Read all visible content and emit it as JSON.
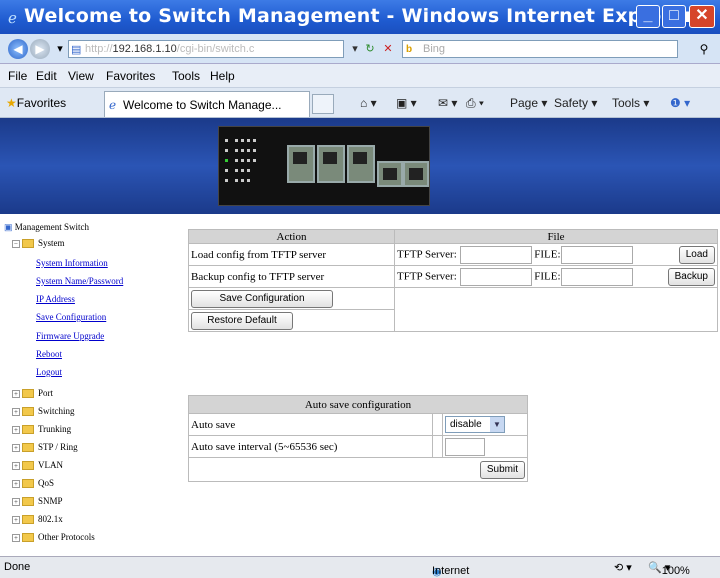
{
  "window": {
    "title": "Welcome to Switch Management - Windows Internet Explorer"
  },
  "address_bar": {
    "url_prefix": "http://",
    "url_host": "192.168.1.10",
    "url_rest": "/cgi-bin/switch.c",
    "search_placeholder": "Bing"
  },
  "menu": [
    "File",
    "Edit",
    "View",
    "Favorites",
    "Tools",
    "Help"
  ],
  "favorites_bar": {
    "favorites_label": "Favorites",
    "tab_title": "Welcome to Switch Manage...",
    "commands": [
      "Page ▾",
      "Safety ▾",
      "Tools ▾"
    ]
  },
  "tree": {
    "root": "Management Switch",
    "system": "System",
    "system_links": [
      "System Information",
      "System Name/Password",
      "IP Address",
      "Save Configuration",
      "Firmware Upgrade",
      "Reboot",
      "Logout"
    ],
    "folders": [
      "Port",
      "Switching",
      "Trunking",
      "STP / Ring",
      "VLAN",
      "QoS",
      "SNMP",
      "802.1x",
      "Other Protocols"
    ]
  },
  "action_table": {
    "header_action": "Action",
    "header_file": "File",
    "rows": [
      {
        "label": "Load config from TFTP server",
        "server_label": "TFTP Server:",
        "file_label": "FILE:",
        "button": "Load"
      },
      {
        "label": "Backup config to TFTP server",
        "server_label": "TFTP Server:",
        "file_label": "FILE:",
        "button": "Backup"
      }
    ],
    "save_button": "Save Configuration",
    "restore_button": "Restore Default"
  },
  "auto_save": {
    "header": "Auto save configuration",
    "auto_save_label": "Auto save",
    "auto_save_value": "disable",
    "interval_label": "Auto save interval (5~65536 sec)",
    "interval_value": "",
    "submit": "Submit"
  },
  "status_bar": {
    "left": "Done",
    "zone": "Internet",
    "zoom": "100%"
  }
}
